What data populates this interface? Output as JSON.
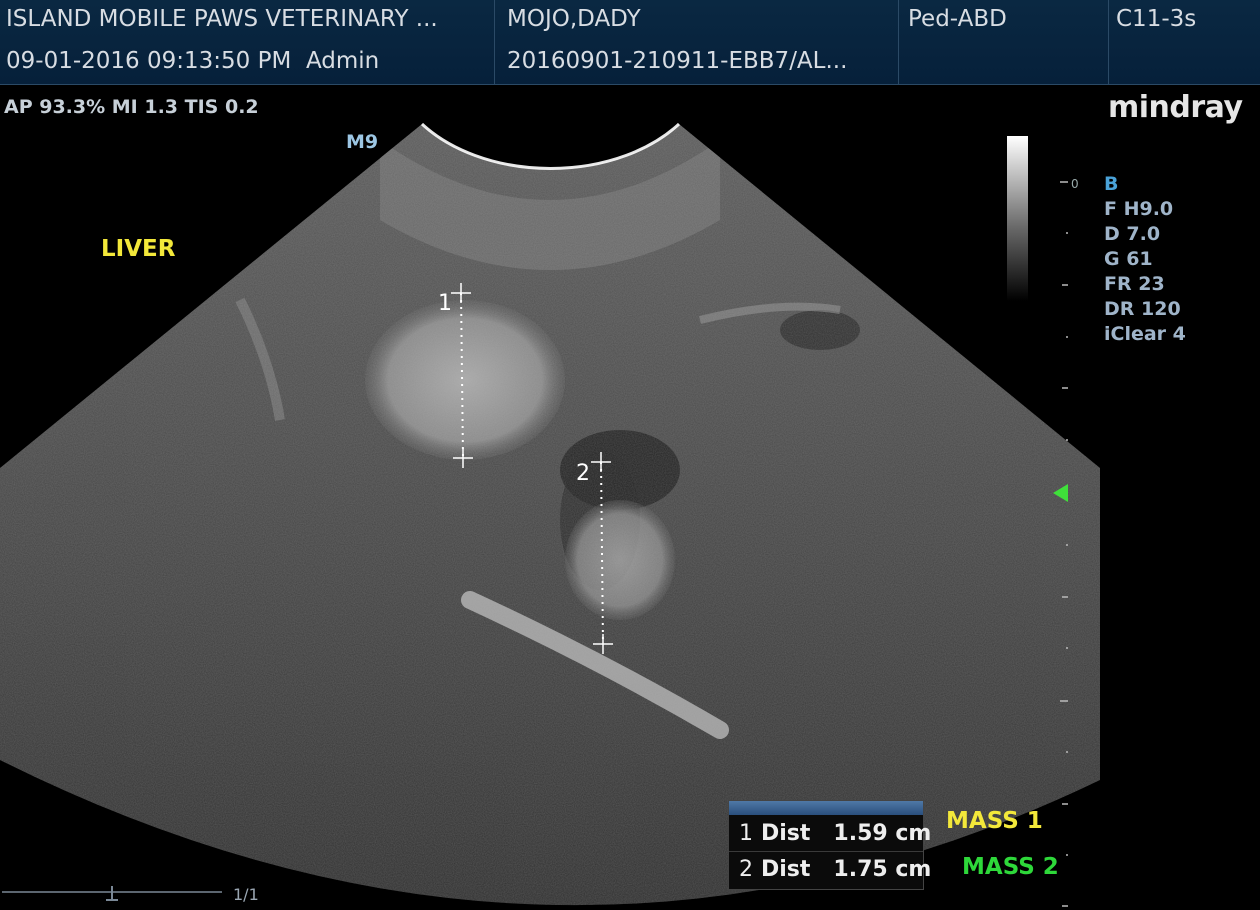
{
  "header": {
    "institution": "ISLAND MOBILE PAWS VETERINARY ...",
    "datetime": "09-01-2016 09:13:50 PM",
    "operator": "Admin",
    "patient_name": "MOJO,DADY",
    "exam_id": "20160901-210911-EBB7/AL...",
    "exam_type": "Ped-ABD",
    "probe": "C11-3s"
  },
  "status_line": "AP 93.3%  MI 1.3 TIS 0.2",
  "logo": "mindray",
  "image": {
    "preset_marker": "M9",
    "organ_label": "LIVER",
    "caliper_1_label": "1",
    "caliper_2_label": "2",
    "depth_scale_mark": "0"
  },
  "params": {
    "mode": "B",
    "frequency": "F H9.0",
    "depth": "D 7.0",
    "gain": "G 61",
    "frame_rate": "FR 23",
    "dynamic_range": "DR 120",
    "iclear": "iClear 4"
  },
  "measurements": [
    {
      "index": "1",
      "type": "Dist",
      "value": "1.59 cm",
      "annotation": "MASS 1"
    },
    {
      "index": "2",
      "type": "Dist",
      "value": "1.75 cm",
      "annotation": "MASS 2"
    }
  ],
  "cine": {
    "page": "1/1"
  },
  "colors": {
    "header_bg": "#06203a",
    "annotation_yellow": "#f3e83a",
    "annotation_green": "#2ed83a",
    "focus_marker": "#3fe03a",
    "param_text": "#9fb4c9"
  }
}
